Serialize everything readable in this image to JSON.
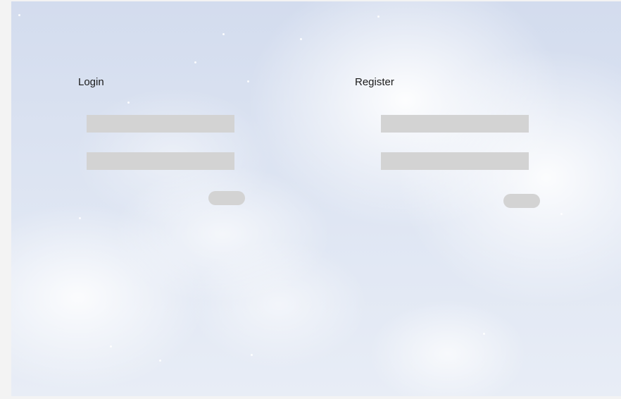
{
  "login": {
    "title": "Login",
    "username_value": "",
    "password_value": "",
    "submit_label": ""
  },
  "register": {
    "title": "Register",
    "username_value": "",
    "password_value": "",
    "submit_label": ""
  }
}
